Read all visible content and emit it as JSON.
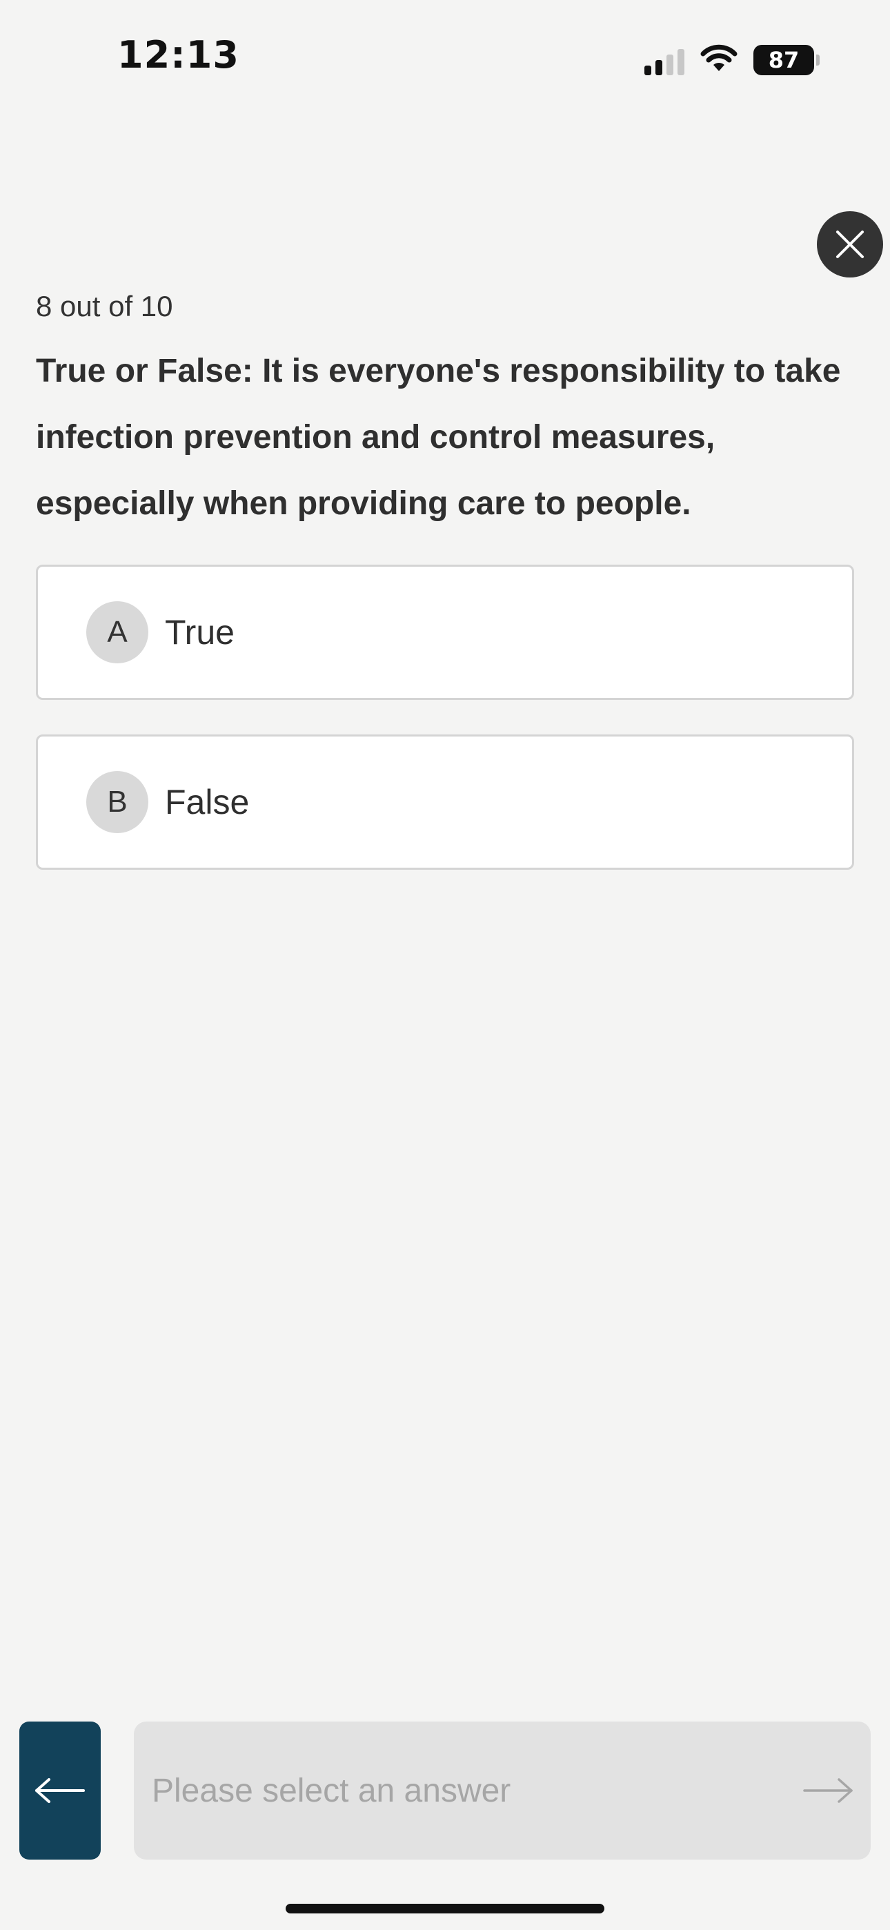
{
  "status_bar": {
    "time": "12:13",
    "battery": "87",
    "icons": [
      "signal-icon",
      "wifi-icon",
      "battery-icon"
    ]
  },
  "quiz": {
    "progress": "8 out of 10",
    "question": "True or False: It is everyone's responsibility to take infection prevention and control measures, especially when providing care to people.",
    "options": [
      {
        "letter": "A",
        "label": "True"
      },
      {
        "letter": "B",
        "label": "False"
      }
    ]
  },
  "footer": {
    "submit_label": "Please select an answer",
    "back_icon": "arrow-left-icon",
    "next_icon": "arrow-right-icon"
  },
  "colors": {
    "background": "#f4f4f3",
    "back_button": "#12425a",
    "close_button": "#333333",
    "disabled_button": "#e2e2e2",
    "disabled_text": "#a6a6a6"
  }
}
